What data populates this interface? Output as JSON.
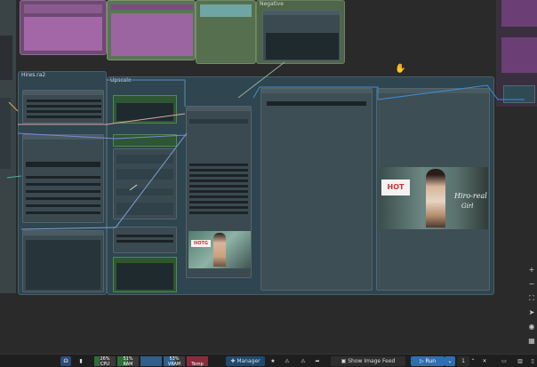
{
  "groups": {
    "group_left_title": "Hires.ra2",
    "group_mid_title": "Upscale",
    "group_top_title": "Negative"
  },
  "image_preview": {
    "poster_title": "Hiro-real",
    "poster_sub": "Girl"
  },
  "taskbar": {
    "cpu_label": "CPU",
    "cpu_value": "26%",
    "ram_label": "RAM",
    "ram_value": "51%",
    "gpu_value": "",
    "vram_label": "VRAM",
    "vram_value": "53%",
    "temp_label": "Temp",
    "manager_label": "Manager",
    "show_image_feed_label": "Show Image Feed",
    "run_label": "Run",
    "queue_count": "1"
  },
  "colors": {
    "accent_blue": "#3d8fd6",
    "group_purple": "#a35aa6",
    "group_green": "#5e7a58",
    "group_teal": "#2f4550"
  }
}
